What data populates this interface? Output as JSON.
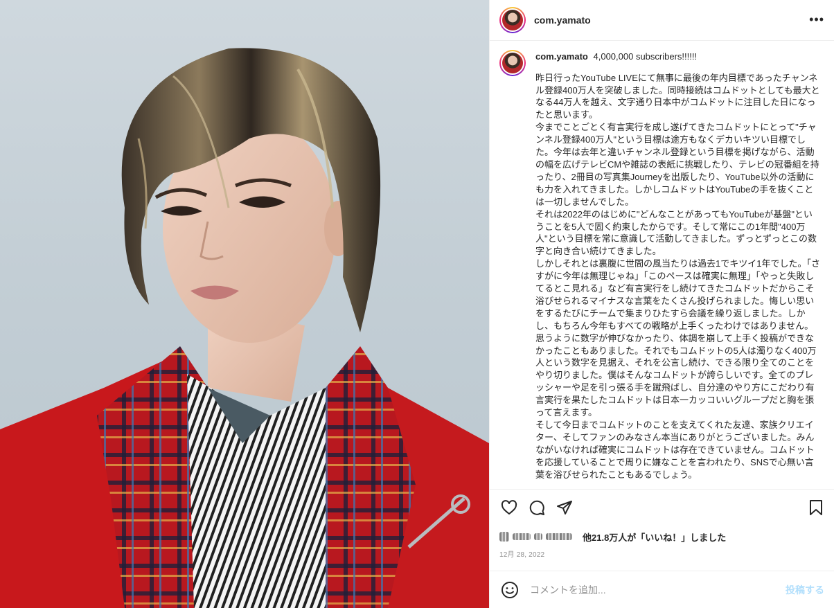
{
  "post": {
    "header_username": "com.yamato",
    "more_label": "•••",
    "caption_username": "com.yamato",
    "caption_title": "4,000,000 subscribers!!!!!!",
    "caption_paragraphs": [
      "昨日行ったYouTube LIVEにて無事に最後の年内目標であったチャンネル登録400万人を突破しました。同時接続はコムドットとしても最大となる44万人を越え、文字通り日本中がコムドットに注目した日になったと思います。",
      "今までことごとく有言実行を成し遂げてきたコムドットにとって\"チャンネル登録400万人\"という目標は途方もなくデカいキツい目標でした。今年は去年と違いチャンネル登録という目標を掲げながら、活動の幅を広げテレビCMや雑誌の表紙に挑戦したり、テレビの冠番組を持ったり、2冊目の写真集Journeyを出版したり、YouTube以外の活動にも力を入れてきました。しかしコムドットはYouTubeの手を抜くことは一切しませんでした。",
      "それは2022年のはじめに\"どんなことがあってもYouTubeが基盤\"ということを5人で固く約束したからです。そして常にこの1年間\"400万人\"という目標を常に意識して活動してきました。ずっとずっとこの数字と向き合い続けてきました。",
      "しかしそれとは裏腹に世間の風当たりは過去1でキツイ1年でした。「さすがに今年は無理じゃね」「このペースは確実に無理」「やっと失敗してるとこ見れる」など有言実行をし続けてきたコムドットだからこそ浴びせられるマイナスな言葉をたくさん投げられました。悔しい思いをするたびにチームで集まりひたすら会議を繰り返しました。しかし、もちろん今年もすべての戦略が上手くったわけではありません。思うように数字が伸びなかったり、体調を崩して上手く投稿ができなかったこともありました。それでもコムドットの5人は濁りなく400万人という数字を見据え、それを公言し続け、できる限り全てのことをやり切りました。僕はそんなコムドットが誇らしいです。全てのプレッシャーや足を引っ張る手を蹴飛ばし、自分達のやり方にこだわり有言実行を果たしたコムドットは日本一カッコいいグループだと胸を張って言えます。",
      "そして今日までコムドットのことを支えてくれた友達、家族クリエイター、そしてファンのみなさん本当にありがとうございました。みんながいなければ確実にコムドットは存在できていません。コムドットを応援していることで周りに嫌なことを言われたり、SNSで心無い言葉を浴びせられたこともあるでしょう。"
    ],
    "likes_text": "他21.8万人が「いいね！」しました",
    "date": "12月 28, 2022",
    "comment_placeholder": "コメントを追加...",
    "post_button": "投稿する"
  },
  "icons": [
    "heart-icon",
    "comment-icon",
    "share-icon",
    "bookmark-icon",
    "emoji-icon",
    "more-icon"
  ],
  "colors": {
    "border": "#efefef",
    "text": "#262626",
    "muted": "#8e8e8e",
    "post_button_disabled": "#b2dffc",
    "jacket_red": "#c8181c"
  }
}
